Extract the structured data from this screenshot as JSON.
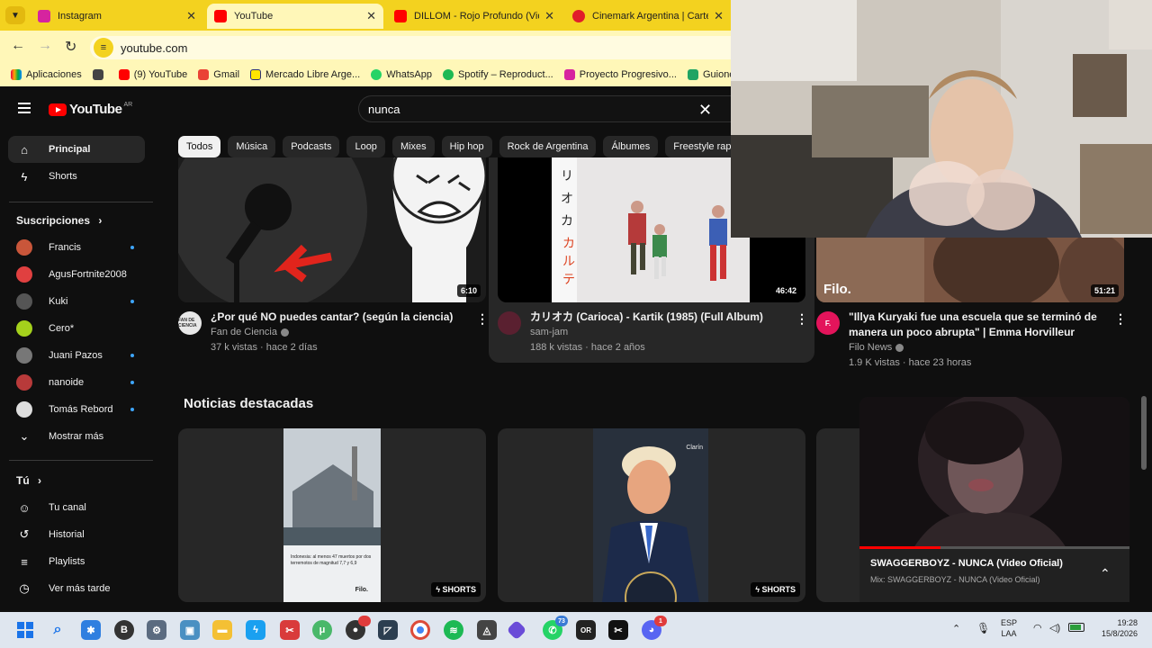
{
  "browser": {
    "tabs": [
      {
        "title": "Instagram",
        "color": "#d6249f"
      },
      {
        "title": "YouTube",
        "color": "#ff0000"
      },
      {
        "title": "DILLOM - Rojo Profundo (Video",
        "color": "#ff0000"
      },
      {
        "title": "Cinemark Argentina | Cartelera",
        "color": "#e11d2a"
      }
    ],
    "url": "youtube.com",
    "bookmarks": [
      {
        "label": "Aplicaciones",
        "color": "#444444"
      },
      {
        "label": "(9) YouTube",
        "color": "#ff0000"
      },
      {
        "label": "Gmail",
        "color": "#ea4335"
      },
      {
        "label": "Mercado Libre Arge...",
        "color": "#ffe600"
      },
      {
        "label": "WhatsApp",
        "color": "#25d366"
      },
      {
        "label": "Spotify – Reproduct...",
        "color": "#1db954"
      },
      {
        "label": "Proyecto Progresivo...",
        "color": "#d6249f"
      },
      {
        "label": "Guiones a fi",
        "color": "#1fa463"
      }
    ]
  },
  "header": {
    "logo": "YouTube",
    "country": "AR",
    "search_value": "nunca"
  },
  "chips": [
    "Todos",
    "Música",
    "Podcasts",
    "Loop",
    "Mixes",
    "Hip hop",
    "Rock de Argentina",
    "Álbumes",
    "Freestyle rap"
  ],
  "sidebar": {
    "main": [
      {
        "label": "Principal",
        "icon": "home-icon"
      },
      {
        "label": "Shorts",
        "icon": "shorts-icon"
      }
    ],
    "subs_title": "Suscripciones",
    "subs": [
      {
        "label": "Francis",
        "color": "#c9563a",
        "dot": true
      },
      {
        "label": "AgusFortnite2008",
        "color": "#e04040",
        "dot": false
      },
      {
        "label": "Kuki",
        "color": "#555555",
        "dot": true
      },
      {
        "label": "Cero*",
        "color": "#a4d11c",
        "dot": false
      },
      {
        "label": "Juani Pazos",
        "color": "#777777",
        "dot": true
      },
      {
        "label": "nanoide",
        "color": "#b83a3a",
        "dot": true
      },
      {
        "label": "Tomás Rebord",
        "color": "#dddddd",
        "dot": true
      }
    ],
    "more": "Mostrar más",
    "you_title": "Tú",
    "you": [
      {
        "label": "Tu canal",
        "icon": "channel-icon"
      },
      {
        "label": "Historial",
        "icon": "history-icon"
      },
      {
        "label": "Playlists",
        "icon": "playlists-icon"
      },
      {
        "label": "Ver más tarde",
        "icon": "watch-later-icon"
      }
    ]
  },
  "videos": [
    {
      "title": "¿Por qué NO puedes cantar? (según la ciencia)",
      "channel": "Fan de Ciencia",
      "meta": "37 k vistas · hace 2 días",
      "duration": "6:10",
      "avatar_text": "FAN DE CIENCIA"
    },
    {
      "title": "カリオカ (Carioca) - Kartik (1985) (Full Album)",
      "channel": "sam-jam",
      "meta": "188 k vistas · hace 2 años",
      "duration": "46:42",
      "avatar_text": ""
    },
    {
      "title_line1": "\"Illya Kuryaki fue una escuela que se terminó de",
      "title_line2": "manera un poco abrupta\" | Emma Horvilleur",
      "channel": "Filo News",
      "meta": "1.9 K vistas · hace 23 horas",
      "duration": "51:21",
      "avatar_text": "F.",
      "thumb_brand": "Filo."
    }
  ],
  "news": {
    "title": "Noticias destacadas",
    "items": [
      {
        "badge": "SHORTS",
        "caption": "Indonesia: al menos 47 muertos por dos terremotos de magnitud 7,7 y 6,9",
        "brand": "Filo."
      },
      {
        "badge": "SHORTS",
        "brand": "Clarín"
      }
    ]
  },
  "miniplayer": {
    "title": "SWAGGERBOYZ - NUNCA (Video Oficial)",
    "subtitle": "Mix: SWAGGERBOYZ - NUNCA (Video Oficial)",
    "progress": 0.3
  },
  "taskbar": {
    "lang1": "ESP",
    "lang2": "LAA",
    "time": "19:28",
    "date": "15/8/2026",
    "whatsapp_badge": "73",
    "discord_badge": "1"
  }
}
